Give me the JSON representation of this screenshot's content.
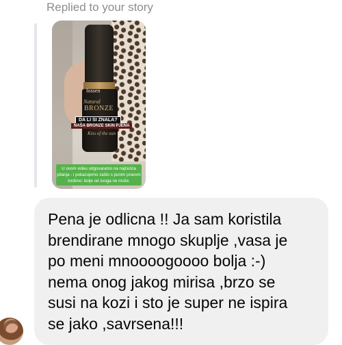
{
  "reply_header": {
    "text": "Replied to your story"
  },
  "story": {
    "brand": "fossen",
    "product_line_1": "Natural",
    "product_line_2": "BRONZE",
    "headline": "DA LI SI ZNALA?",
    "subheadline": "NAŠA BRONZE SKIN PJENA",
    "script_text": "Kiss of the sun",
    "caption": "U ovom videu odgovaramo na najčešća pitanja - i pokazujemo zašto s punim pravom tvrdimo: bolje od svoga ne može."
  },
  "message": {
    "text": "Pena je odlicna !! Ja sam koristila\nbrendirane mnogo skuplje ,vasa je\npo meni mnoooogoooo bolja :-)\nnema onog jakog mirisa ,brzo se\nsusi na kozi i sto je super ne ispira\nse jako ,savrsena!!!"
  },
  "sender": {
    "avatar_icon": "user-avatar"
  },
  "colors": {
    "bubble": "#f0f0f0",
    "meta_text": "#8a8d91",
    "caption_green": "#55b24b"
  }
}
